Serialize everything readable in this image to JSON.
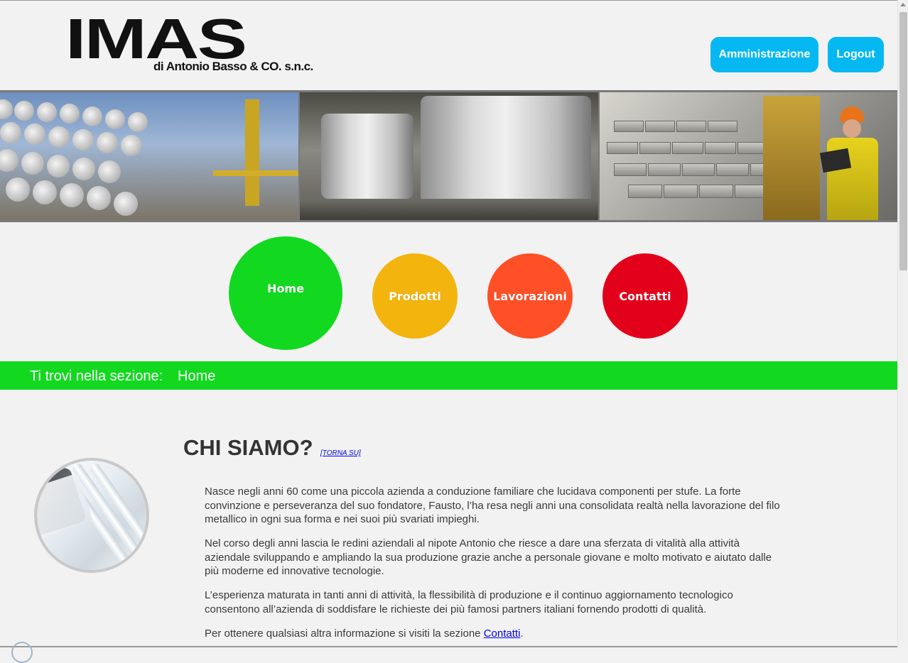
{
  "header": {
    "logo_main": "IMAS",
    "logo_sub": "di Antonio Basso & CO. s.n.c.",
    "buttons": {
      "admin": "Amministrazione",
      "logout": "Logout"
    }
  },
  "nav": {
    "home": "Home",
    "prodotti": "Prodotti",
    "lavorazioni": "Lavorazioni",
    "contatti": "Contatti"
  },
  "section_bar": {
    "label": "Ti trovi nella sezione:",
    "value": "Home"
  },
  "content": {
    "heading": "CHI SIAMO?",
    "torna_su": "[TORNA SU]",
    "p1": "Nasce negli anni 60 come una piccola azienda a conduzione familiare che lucidava componenti per stufe. La forte convinzione e perseveranza del suo fondatore, Fausto, l’ha resa negli anni una consolidata realtà nella lavorazione del filo metallico in ogni sua forma e nei suoi più svariati impieghi.",
    "p2": "Nel corso degli anni lascia le redini aziendali al nipote Antonio che riesce a dare una sferzata di vitalità alla attività aziendale sviluppando e ampliando la sua produzione grazie anche a personale giovane e molto motivato e aiutato dalle più moderne ed innovative tecnologie.",
    "p3": "L’esperienza maturata in tanti anni di attività, la flessibilità di produzione e il continuo aggiornamento tecnologico consentono all’azienda di soddisfare le richieste dei più famosi partners italiani fornendo prodotti di qualità.",
    "p4_prefix": "Per ottenere qualsiasi altra informazione si visiti la sezione ",
    "p4_link": "Contatti",
    "p4_suffix": "."
  },
  "colors": {
    "home": "#12d91f",
    "prodotti": "#f2b40d",
    "lavorazioni": "#ff4f26",
    "contatti": "#e3001b",
    "button": "#05b8f2"
  }
}
